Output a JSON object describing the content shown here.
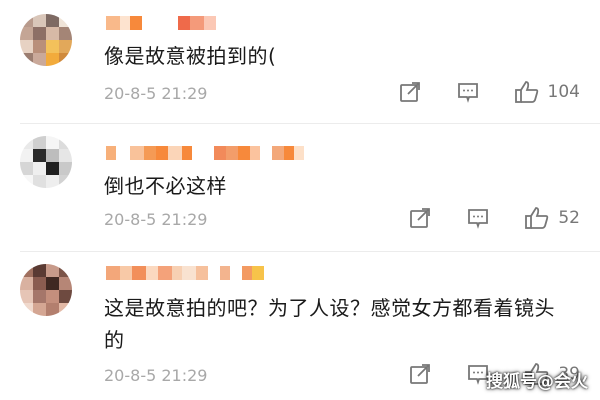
{
  "comments": [
    {
      "text": "像是故意被拍到的(",
      "date": "20-8-5 21:29",
      "likes": "104",
      "icons": [
        "share-icon",
        "comment-icon",
        "thumbs-up-icon"
      ]
    },
    {
      "text": "倒也不必这样",
      "date": "20-8-5 21:29",
      "likes": "52",
      "icons": [
        "share-icon",
        "comment-icon",
        "thumbs-up-icon"
      ]
    },
    {
      "text": "这是故意拍的吧？为了人设？感觉女方都看着镜头的",
      "date": "20-8-5 21:29",
      "likes": "39",
      "icons": [
        "share-icon",
        "comment-icon",
        "thumbs-up-icon"
      ]
    }
  ],
  "watermark": "搜狐号@会火",
  "colors": {
    "name_orange": "#f7893b",
    "name_red": "#ef5a4a",
    "meta_gray": "#a8a8a8",
    "text": "#1a1a1a"
  }
}
